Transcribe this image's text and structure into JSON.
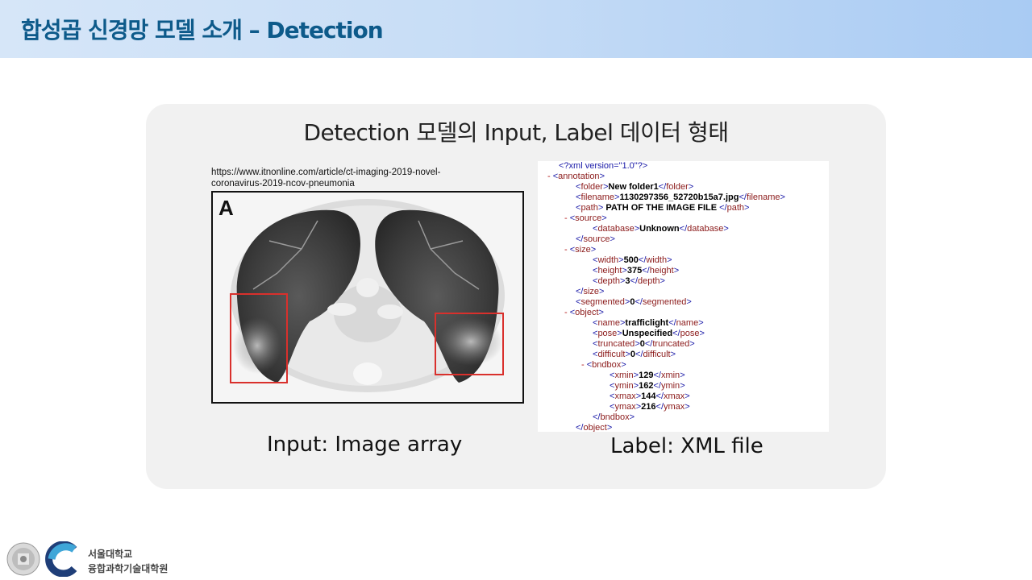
{
  "slide": {
    "title": "합성곱 신경망 모델 소개 – Detection",
    "panel_title": "Detection 모델의 Input, Label 데이터 형태",
    "source_url": "https://www.itnonline.com/article/ct-imaging-2019-novel-coronavirus-2019-ncov-pneumonia",
    "ct_label": "A",
    "input_caption": "Input: Image array",
    "label_caption": "Label: XML file"
  },
  "xml": {
    "pi": "<?xml version=\"1.0\"?>",
    "lines": [
      {
        "indent": 0,
        "marker": "-",
        "tag": "annotation",
        "kind": "open"
      },
      {
        "indent": 1,
        "marker": "",
        "tag": "folder",
        "value": "New folder1",
        "kind": "leaf"
      },
      {
        "indent": 1,
        "marker": "",
        "tag": "filename",
        "value": "1130297356_52720b15a7.jpg",
        "kind": "leaf"
      },
      {
        "indent": 1,
        "marker": "",
        "tag": "path",
        "value": " PATH OF THE IMAGE FILE  ",
        "kind": "leaf"
      },
      {
        "indent": 1,
        "marker": "-",
        "tag": "source",
        "kind": "open"
      },
      {
        "indent": 2,
        "marker": "",
        "tag": "database",
        "value": "Unknown",
        "kind": "leaf"
      },
      {
        "indent": 1,
        "marker": "",
        "tag": "source",
        "kind": "close"
      },
      {
        "indent": 1,
        "marker": "-",
        "tag": "size",
        "kind": "open"
      },
      {
        "indent": 2,
        "marker": "",
        "tag": "width",
        "value": "500",
        "kind": "leaf"
      },
      {
        "indent": 2,
        "marker": "",
        "tag": "height",
        "value": "375",
        "kind": "leaf"
      },
      {
        "indent": 2,
        "marker": "",
        "tag": "depth",
        "value": "3",
        "kind": "leaf"
      },
      {
        "indent": 1,
        "marker": "",
        "tag": "size",
        "kind": "close"
      },
      {
        "indent": 1,
        "marker": "",
        "tag": "segmented",
        "value": "0",
        "kind": "leaf"
      },
      {
        "indent": 1,
        "marker": "-",
        "tag": "object",
        "kind": "open"
      },
      {
        "indent": 2,
        "marker": "",
        "tag": "name",
        "value": "trafficlight",
        "kind": "leaf"
      },
      {
        "indent": 2,
        "marker": "",
        "tag": "pose",
        "value": "Unspecified",
        "kind": "leaf"
      },
      {
        "indent": 2,
        "marker": "",
        "tag": "truncated",
        "value": "0",
        "kind": "leaf"
      },
      {
        "indent": 2,
        "marker": "",
        "tag": "difficult",
        "value": "0",
        "kind": "leaf"
      },
      {
        "indent": 2,
        "marker": "-",
        "tag": "bndbox",
        "kind": "open"
      },
      {
        "indent": 3,
        "marker": "",
        "tag": "xmin",
        "value": "129",
        "kind": "leaf"
      },
      {
        "indent": 3,
        "marker": "",
        "tag": "ymin",
        "value": "162",
        "kind": "leaf"
      },
      {
        "indent": 3,
        "marker": "",
        "tag": "xmax",
        "value": "144",
        "kind": "leaf"
      },
      {
        "indent": 3,
        "marker": "",
        "tag": "ymax",
        "value": "216",
        "kind": "leaf"
      },
      {
        "indent": 2,
        "marker": "",
        "tag": "bndbox",
        "kind": "close"
      },
      {
        "indent": 1,
        "marker": "",
        "tag": "object",
        "kind": "close"
      }
    ]
  },
  "footer": {
    "line1": "서울대학교",
    "line2": "융합과학기술대학원"
  },
  "colors": {
    "header_title": "#0d5a8a",
    "bbox": "#d9302c",
    "xml_bracket": "#1a1aa8",
    "xml_tag": "#8b1a1a"
  }
}
